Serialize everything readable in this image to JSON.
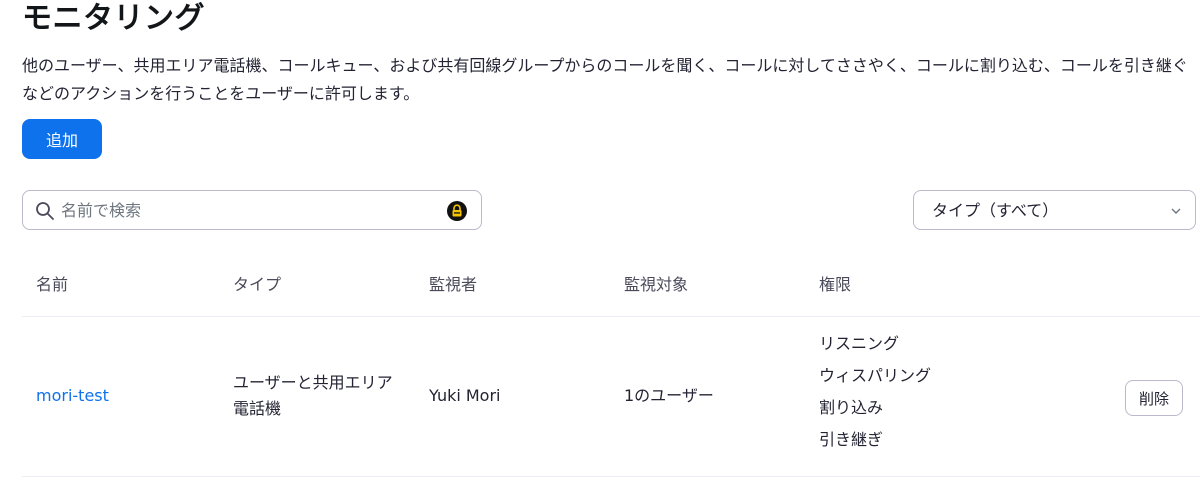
{
  "page": {
    "title": "モニタリング",
    "description": "他のユーザー、共用エリア電話機、コールキュー、および共有回線グループからのコールを聞く、コールに対してささやく、コールに割り込む、コールを引き継ぐなどのアクションを行うことをユーザーに許可します。"
  },
  "toolbar": {
    "add_label": "追加"
  },
  "search": {
    "placeholder": "名前で検索",
    "value": "",
    "icon": "search-icon",
    "extension_icon": "lock-icon"
  },
  "filter": {
    "selected": "タイプ（すべて）",
    "icon": "chevron-down-icon"
  },
  "table": {
    "headers": [
      "名前",
      "タイプ",
      "監視者",
      "監視対象",
      "権限"
    ],
    "rows": [
      {
        "name": "mori-test",
        "type": "ユーザーと共用エリア電話機",
        "monitor": "Yuki Mori",
        "target": "1のユーザー",
        "permissions": [
          "リスニング",
          "ウィスパリング",
          "割り込み",
          "引き継ぎ"
        ],
        "delete_label": "削除"
      }
    ]
  },
  "colors": {
    "accent": "#0e72ed",
    "text": "#232333",
    "border": "#babacc"
  }
}
